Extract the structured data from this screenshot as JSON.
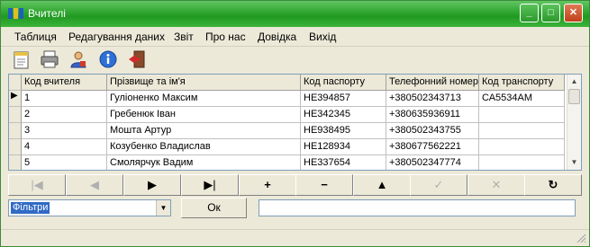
{
  "window": {
    "title": "Вчителі"
  },
  "menu": [
    "Таблиця",
    "Редагування даних",
    "Звіт",
    "Про нас",
    "Довідка",
    "Вихід"
  ],
  "toolbar": {
    "icons": [
      "notepad-icon",
      "printer-icon",
      "user-icon",
      "info-icon",
      "exit-icon"
    ]
  },
  "table": {
    "columns": [
      "Код вчителя",
      "Прізвище та ім'я",
      "Код паспорту",
      "Телефонний номер",
      "Код транспорту"
    ],
    "rows": [
      [
        "1",
        "Гуліоненко Максим",
        "НЕ394857",
        "+380502343713",
        "СА5534АМ"
      ],
      [
        "2",
        "Гребенюк Іван",
        "НЕ342345",
        "+380635936911",
        ""
      ],
      [
        "3",
        "Мошта Артур",
        "НЕ938495",
        "+380502343755",
        ""
      ],
      [
        "4",
        "Козубенко Владислав",
        "НЕ128934",
        "+380677562221",
        ""
      ],
      [
        "5",
        "Смолярчук Вадим",
        "НЕ337654",
        "+380502347774",
        ""
      ]
    ]
  },
  "navigator": [
    "|◀",
    "◀",
    "▶",
    "▶|",
    "+",
    "−",
    "▲",
    "✓",
    "✕",
    "↻"
  ],
  "filters": {
    "selected": "Фільтри",
    "ok_label": "Ок",
    "value": ""
  }
}
